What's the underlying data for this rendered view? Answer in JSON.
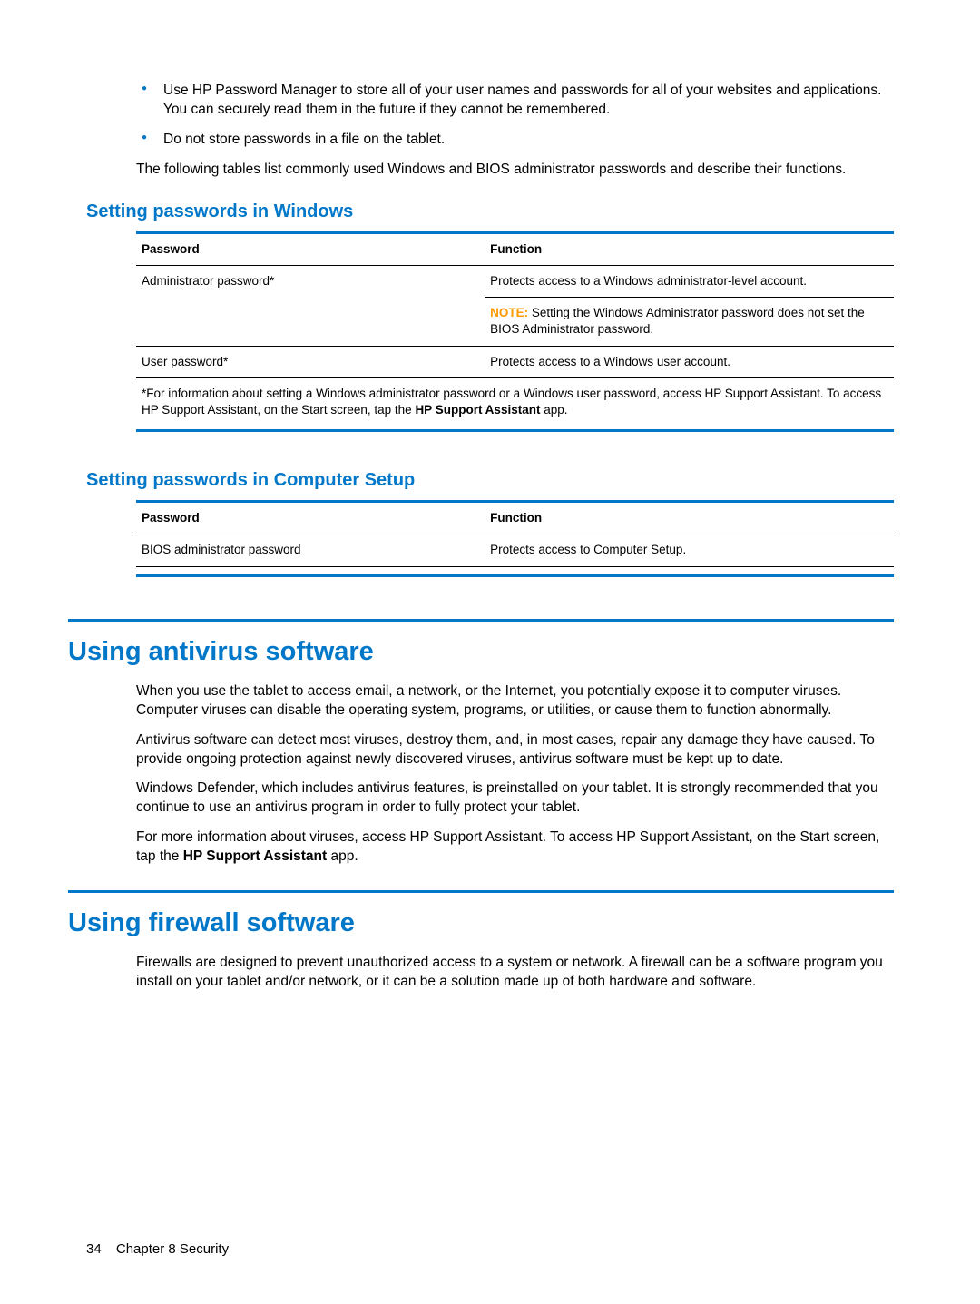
{
  "bullets": [
    "Use HP Password Manager to store all of your user names and passwords for all of your websites and applications. You can securely read them in the future if they cannot be remembered.",
    "Do not store passwords in a file on the tablet."
  ],
  "intro_para": "The following tables list commonly used Windows and BIOS administrator passwords and describe their functions.",
  "section_windows": {
    "heading": "Setting passwords in Windows",
    "col1": "Password",
    "col2": "Function",
    "rows": [
      {
        "password": "Administrator password*",
        "func_main": "Protects access to a Windows administrator-level account.",
        "note_label": "NOTE:",
        "note_text": "Setting the Windows Administrator password does not set the BIOS Administrator password."
      },
      {
        "password": "User password*",
        "func_main": "Protects access to a Windows user account."
      }
    ],
    "footnote_pre": "*For information about setting a Windows administrator password or a Windows user password, access HP Support Assistant. To access HP Support Assistant, on the Start screen, tap the ",
    "footnote_bold": "HP Support Assistant",
    "footnote_post": " app."
  },
  "section_setup": {
    "heading": "Setting passwords in Computer Setup",
    "col1": "Password",
    "col2": "Function",
    "rows": [
      {
        "password": "BIOS administrator password",
        "func_main": "Protects access to Computer Setup."
      }
    ]
  },
  "section_antivirus": {
    "heading": "Using antivirus software",
    "p1": "When you use the tablet to access email, a network, or the Internet, you potentially expose it to computer viruses. Computer viruses can disable the operating system, programs, or utilities, or cause them to function abnormally.",
    "p2": "Antivirus software can detect most viruses, destroy them, and, in most cases, repair any damage they have caused. To provide ongoing protection against newly discovered viruses, antivirus software must be kept up to date.",
    "p3": "Windows Defender, which includes antivirus features, is preinstalled on your tablet. It is strongly recommended that you continue to use an antivirus program in order to fully protect your tablet.",
    "p4_pre": "For more information about viruses, access HP Support Assistant. To access HP Support Assistant, on the Start screen, tap the ",
    "p4_bold": "HP Support Assistant",
    "p4_post": " app."
  },
  "section_firewall": {
    "heading": "Using firewall software",
    "p1": "Firewalls are designed to prevent unauthorized access to a system or network. A firewall can be a software program you install on your tablet and/or network, or it can be a solution made up of both hardware and software."
  },
  "footer": {
    "page_number": "34",
    "chapter": "Chapter 8   Security"
  }
}
